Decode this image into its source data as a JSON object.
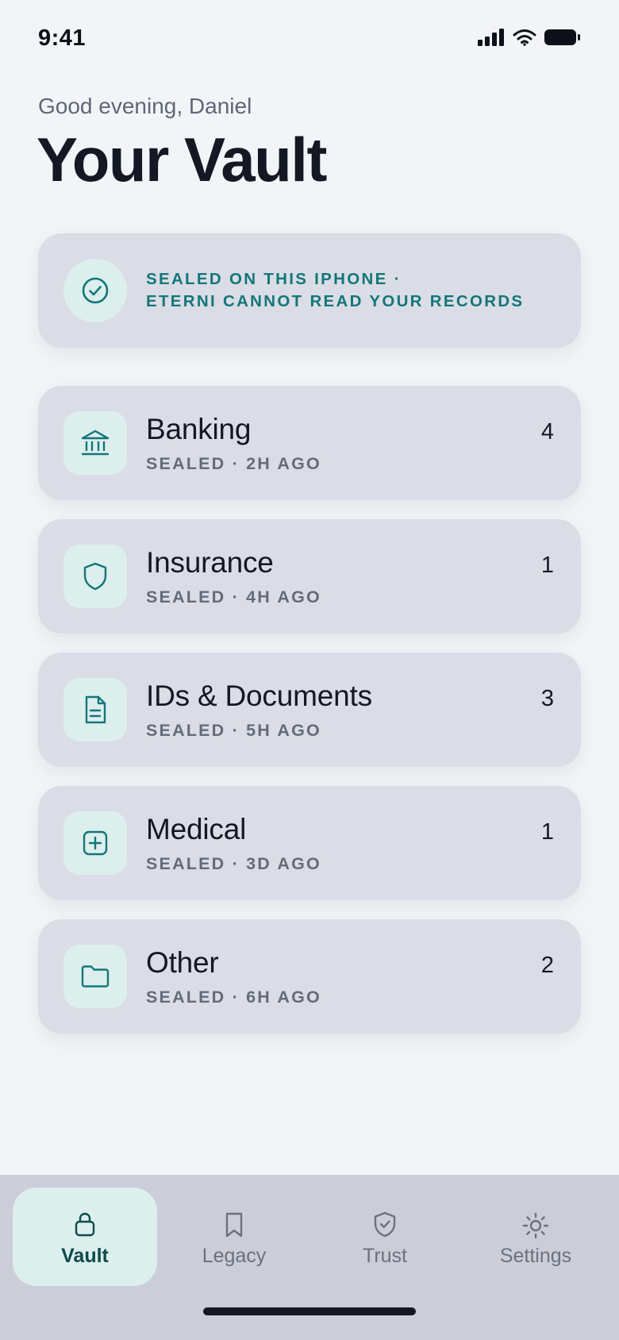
{
  "status_bar": {
    "time": "9:41"
  },
  "header": {
    "greeting": "Good evening, Daniel",
    "title": "Your Vault"
  },
  "seal_banner": {
    "line1": "SEALED ON THIS IPHONE ·",
    "line2": "ETERNI CANNOT READ YOUR RECORDS",
    "icon": "check-circle-icon"
  },
  "categories": [
    {
      "name": "Banking",
      "status": "SEALED · 2H AGO",
      "count": "4",
      "icon": "bank-icon"
    },
    {
      "name": "Insurance",
      "status": "SEALED · 4H AGO",
      "count": "1",
      "icon": "shield-icon"
    },
    {
      "name": "IDs & Documents",
      "status": "SEALED · 5H AGO",
      "count": "3",
      "icon": "document-icon"
    },
    {
      "name": "Medical",
      "status": "SEALED · 3D AGO",
      "count": "1",
      "icon": "medical-plus-icon"
    },
    {
      "name": "Other",
      "status": "SEALED · 6H AGO",
      "count": "2",
      "icon": "folder-icon"
    }
  ],
  "tab_bar": {
    "tabs": [
      {
        "label": "Vault",
        "icon": "lock-icon",
        "active": true
      },
      {
        "label": "Legacy",
        "icon": "bookmark-icon",
        "active": false
      },
      {
        "label": "Trust",
        "icon": "shield-check-icon",
        "active": false
      },
      {
        "label": "Settings",
        "icon": "gear-icon",
        "active": false
      }
    ]
  },
  "colors": {
    "background": "#f2f4f7",
    "card": "#dadde5",
    "accent": "#13767a",
    "accent_soft": "#dcefed",
    "tab_bar": "#cbced9",
    "text_primary": "#141823",
    "text_secondary": "#656b7b"
  }
}
